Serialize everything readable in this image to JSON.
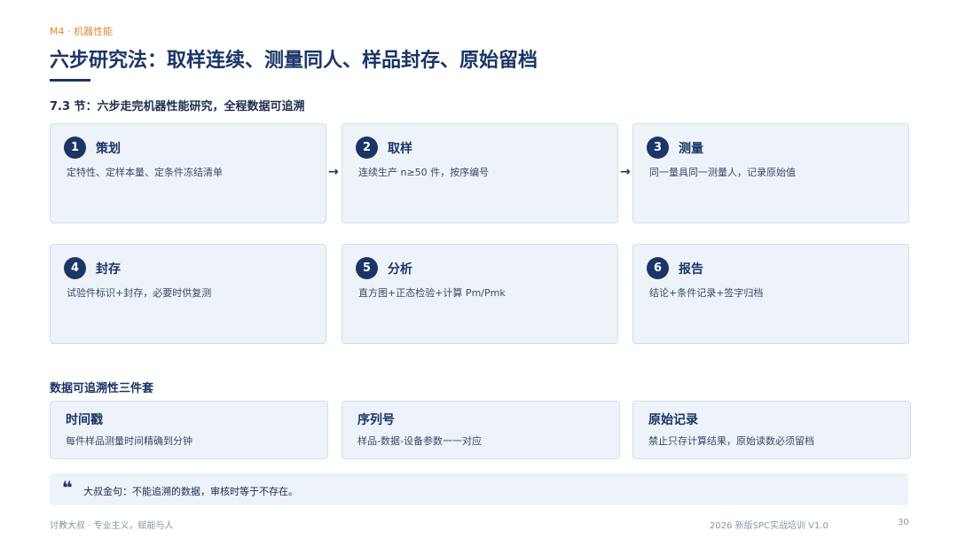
{
  "header": {
    "module_tag": "M4 · 机器性能",
    "title": "六步研究法：取样连续、测量同人、样品封存、原始留档",
    "subtitle": "7.3 节：六步走完机器性能研究，全程数据可追溯"
  },
  "steps": [
    {
      "num": "1",
      "title": "策划",
      "desc": "定特性、定样本量、定条件冻结清单"
    },
    {
      "num": "2",
      "title": "取样",
      "desc": "连续生产 n≥50 件，按序编号"
    },
    {
      "num": "3",
      "title": "测量",
      "desc": "同一量具同一测量人，记录原始值"
    },
    {
      "num": "4",
      "title": "封存",
      "desc": "试验件标识+封存，必要时供复测"
    },
    {
      "num": "5",
      "title": "分析",
      "desc": "直方图+正态检验+计算 Pm/Pmk"
    },
    {
      "num": "6",
      "title": "报告",
      "desc": "结论+条件记录+签字归档"
    }
  ],
  "arrow_glyph": "→",
  "traceability": {
    "heading": "数据可追溯性三件套",
    "items": [
      {
        "title": "时间戳",
        "desc": "每件样品测量时间精确到分钟"
      },
      {
        "title": "序列号",
        "desc": "样品-数据-设备参数一一对应"
      },
      {
        "title": "原始记录",
        "desc": "禁止只存计算结果，原始读数必须留档"
      }
    ]
  },
  "quote": {
    "icon": "quote-icon",
    "text": "大叔金句：不能追溯的数据，审核时等于不存在。"
  },
  "footer": {
    "left": "讨教大叔 · 专业主义，赋能与人",
    "course": "2026 新版SPC实战培训 V1.0",
    "page": "30"
  },
  "colors": {
    "accent_orange": "#e0892e",
    "navy": "#1b3566",
    "card_bg": "#eef3fa"
  }
}
